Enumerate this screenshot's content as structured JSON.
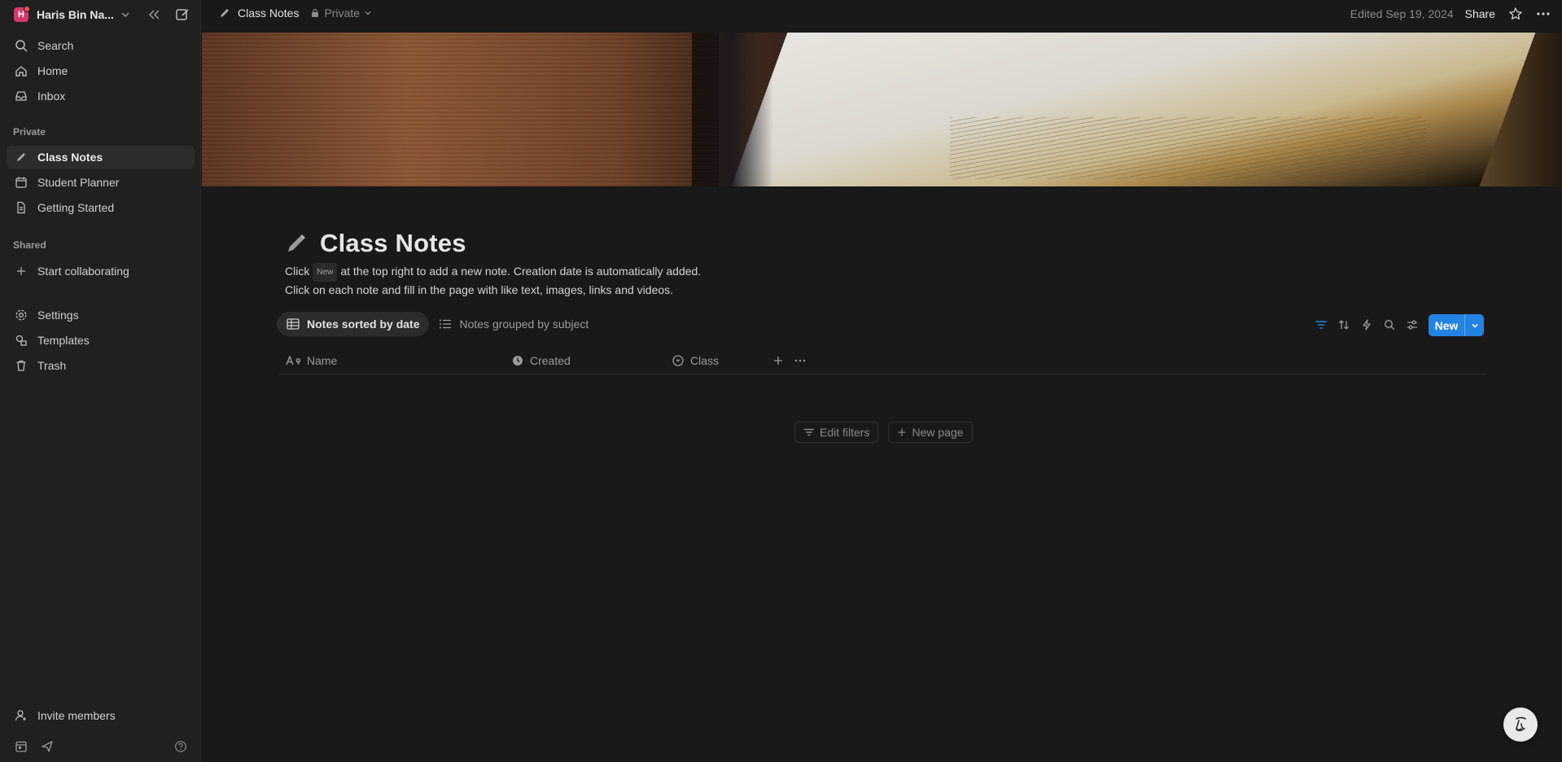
{
  "sidebar": {
    "workspace": {
      "initial": "H",
      "name": "Haris Bin Na..."
    },
    "nav": [
      {
        "label": "Search",
        "icon": "search-icon"
      },
      {
        "label": "Home",
        "icon": "home-icon"
      },
      {
        "label": "Inbox",
        "icon": "inbox-icon"
      }
    ],
    "private_label": "Private",
    "private_pages": [
      {
        "label": "Class Notes",
        "icon": "pencil-icon",
        "active": true
      },
      {
        "label": "Student Planner",
        "icon": "calendar-icon"
      },
      {
        "label": "Getting Started",
        "icon": "document-icon"
      }
    ],
    "shared_label": "Shared",
    "shared_items": [
      {
        "label": "Start collaborating",
        "icon": "plus-icon"
      }
    ],
    "footer_nav": [
      {
        "label": "Settings",
        "icon": "gear-icon"
      },
      {
        "label": "Templates",
        "icon": "templates-icon"
      },
      {
        "label": "Trash",
        "icon": "trash-icon"
      }
    ],
    "invite_label": "Invite members"
  },
  "topbar": {
    "breadcrumb": "Class Notes",
    "privacy": "Private",
    "edited": "Edited Sep 19, 2024",
    "share": "Share"
  },
  "page": {
    "title": "Class Notes",
    "desc_line1_a": "Click",
    "desc_kbd": "New",
    "desc_line1_b": "at the top right to add a new note. Creation date is automatically added.",
    "desc_line2": "Click on each note and fill in the page with like text, images, links and videos."
  },
  "database": {
    "views": [
      {
        "label": "Notes sorted by date",
        "active": true
      },
      {
        "label": "Notes grouped by subject",
        "active": false
      }
    ],
    "new_label": "New",
    "columns": [
      {
        "label": "Name",
        "icon": "text-type-icon"
      },
      {
        "label": "Created",
        "icon": "clock-icon"
      },
      {
        "label": "Class",
        "icon": "select-icon"
      }
    ],
    "empty_actions": {
      "edit_filters": "Edit filters",
      "new_page": "New page"
    }
  },
  "colors": {
    "accent": "#2383e2",
    "background": "#191919",
    "sidebar": "#202020"
  }
}
